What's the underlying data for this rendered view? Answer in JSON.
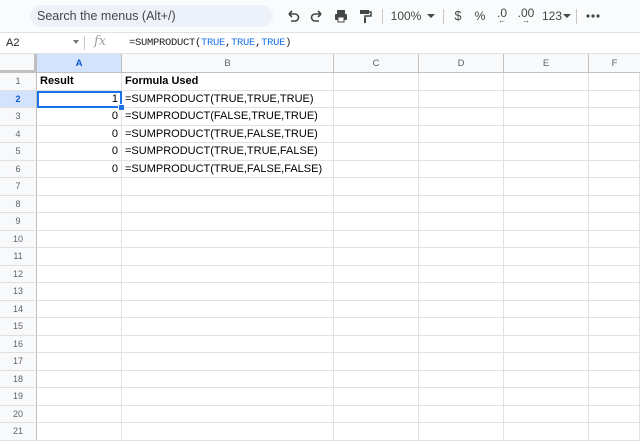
{
  "toolbar": {
    "search_placeholder": "Search the menus (Alt+/)",
    "zoom": "100%",
    "currency": "$",
    "percent": "%",
    "decrease_decimal": ".0",
    "increase_decimal": ".00",
    "number_format": "123"
  },
  "formula_bar": {
    "name_box": "A2",
    "fx": "fx",
    "formula": {
      "prefix": "=SUMPRODUCT(",
      "arg1": "TRUE",
      "sep1": ",",
      "arg2": "TRUE",
      "sep2": ",",
      "arg3": "TRUE",
      "suffix": ")"
    }
  },
  "columns": [
    "A",
    "B",
    "C",
    "D",
    "E",
    "F"
  ],
  "rows": [
    "1",
    "2",
    "3",
    "4",
    "5",
    "6",
    "7",
    "8",
    "9",
    "10",
    "11",
    "12",
    "13",
    "14",
    "15",
    "16",
    "17",
    "18",
    "19",
    "20",
    "21"
  ],
  "cells": {
    "A1": "Result",
    "B1": "Formula Used",
    "A2": "1",
    "B2": "=SUMPRODUCT(TRUE,TRUE,TRUE)",
    "A3": "0",
    "B3": "=SUMPRODUCT(FALSE,TRUE,TRUE)",
    "A4": "0",
    "B4": "=SUMPRODUCT(TRUE,FALSE,TRUE)",
    "A5": "0",
    "B5": "=SUMPRODUCT(TRUE,TRUE,FALSE)",
    "A6": "0",
    "B6": "=SUMPRODUCT(TRUE,FALSE,FALSE)"
  },
  "selection": "A2",
  "colors": {
    "accent": "#1a73e8",
    "header_selected": "#d3e3fd"
  }
}
